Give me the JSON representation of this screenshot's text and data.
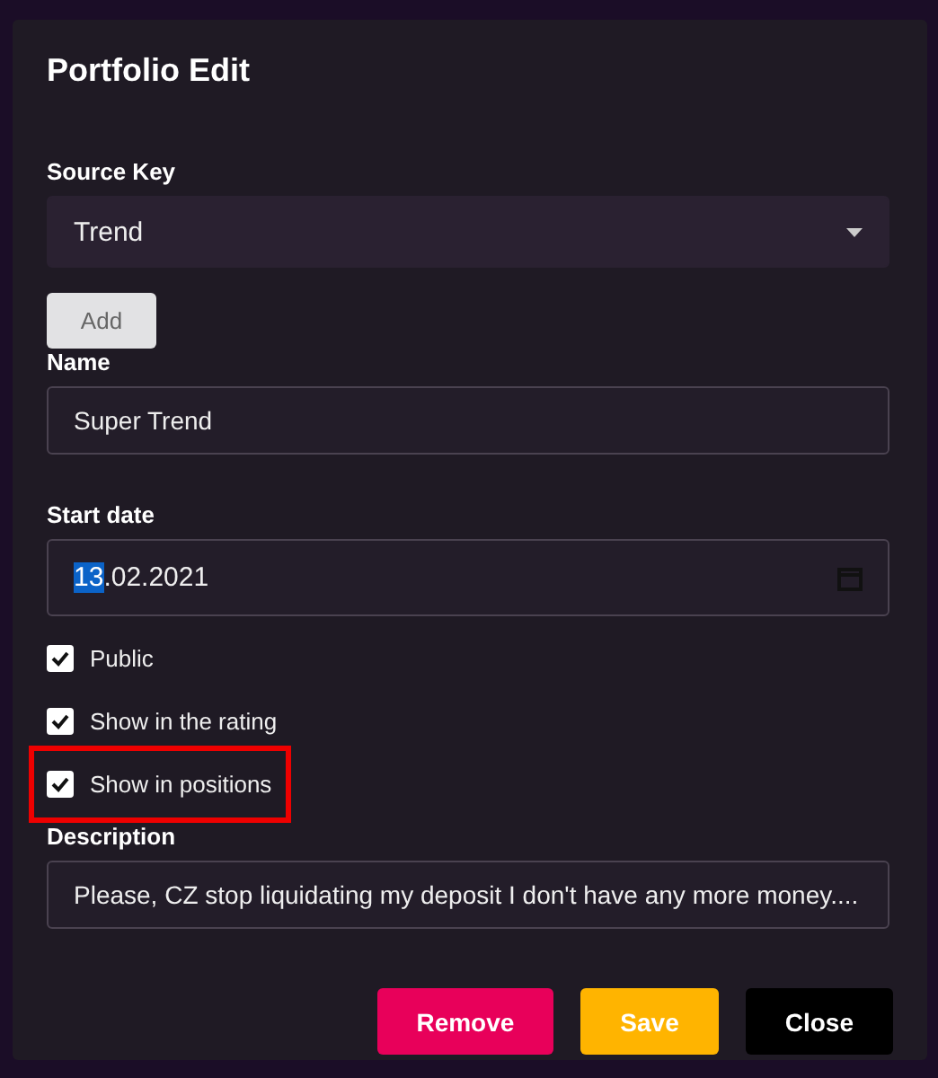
{
  "dialog": {
    "title": "Portfolio Edit"
  },
  "source_key": {
    "label": "Source Key",
    "value": "Trend"
  },
  "add_button": {
    "label": "Add",
    "disabled": true
  },
  "name": {
    "label": "Name",
    "value": "Super Trend"
  },
  "start_date": {
    "label": "Start date",
    "value_parts": [
      {
        "text": "13",
        "selected": true
      },
      {
        "text": ".02.2021",
        "selected": false
      }
    ]
  },
  "checkboxes": [
    {
      "label": "Public",
      "checked": true,
      "highlighted": false
    },
    {
      "label": "Show in the rating",
      "checked": true,
      "highlighted": false
    },
    {
      "label": "Show in positions",
      "checked": true,
      "highlighted": true
    }
  ],
  "description": {
    "label": "Description",
    "value": "Please, CZ stop liquidating my deposit I don't have any more money...."
  },
  "buttons": [
    {
      "label": "Remove",
      "kind": "danger"
    },
    {
      "label": "Save",
      "kind": "warning"
    },
    {
      "label": "Close",
      "kind": "dark"
    }
  ]
}
